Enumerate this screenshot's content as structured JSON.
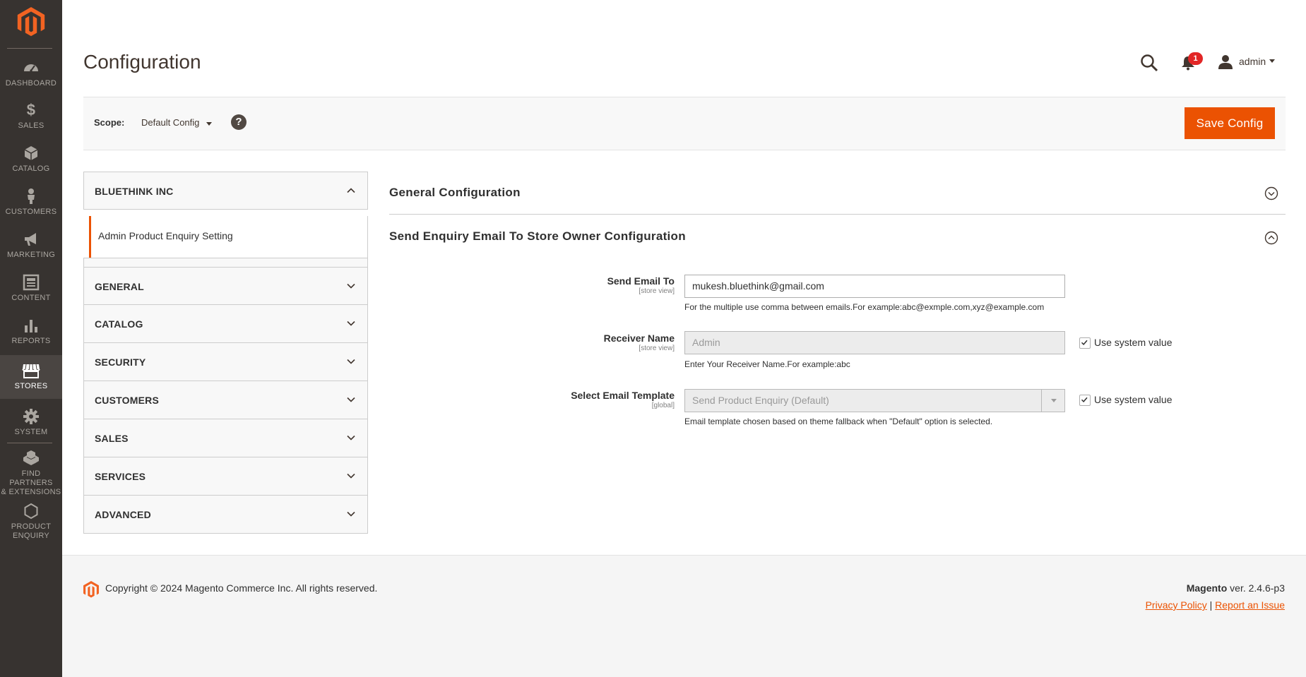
{
  "sidebar": {
    "items": [
      {
        "label": "DASHBOARD",
        "icon": "dashboard-icon"
      },
      {
        "label": "SALES",
        "icon": "dollar-icon"
      },
      {
        "label": "CATALOG",
        "icon": "cube-icon"
      },
      {
        "label": "CUSTOMERS",
        "icon": "person-icon"
      },
      {
        "label": "MARKETING",
        "icon": "megaphone-icon"
      },
      {
        "label": "CONTENT",
        "icon": "content-icon"
      },
      {
        "label": "REPORTS",
        "icon": "bar-chart-icon"
      },
      {
        "label": "STORES",
        "icon": "store-icon"
      },
      {
        "label": "SYSTEM",
        "icon": "gear-icon"
      },
      {
        "label_line1": "FIND PARTNERS",
        "label_line2": "& EXTENSIONS",
        "icon": "boxes-icon"
      },
      {
        "label_line1": "PRODUCT",
        "label_line2": "ENQUIRY",
        "icon": "hexagon-icon"
      }
    ],
    "active": "STORES"
  },
  "header": {
    "title": "Configuration",
    "notification_count": "1",
    "username": "admin"
  },
  "scope_bar": {
    "label": "Scope:",
    "value": "Default Config",
    "help": "?",
    "save_label": "Save Config"
  },
  "tabs": {
    "group_label": "BLUETHINK INC",
    "active_item": "Admin Product Enquiry Setting",
    "items": [
      "GENERAL",
      "CATALOG",
      "SECURITY",
      "CUSTOMERS",
      "SALES",
      "SERVICES",
      "ADVANCED"
    ]
  },
  "sections": {
    "general": {
      "title": "General Configuration"
    },
    "send_enquiry": {
      "title": "Send Enquiry Email To Store Owner Configuration"
    }
  },
  "form": {
    "send_email_to": {
      "label": "Send Email To",
      "scope": "[store view]",
      "value": "mukesh.bluethink@gmail.com",
      "note": "For the multiple use comma between emails.For example:abc@exmple.com,xyz@example.com"
    },
    "receiver_name": {
      "label": "Receiver Name",
      "scope": "[store view]",
      "value": "Admin",
      "note": "Enter Your Receiver Name.For example:abc",
      "use_system_value": "Use system value"
    },
    "email_template": {
      "label": "Select Email Template",
      "scope": "[global]",
      "value": "Send Product Enquiry (Default)",
      "note": "Email template chosen based on theme fallback when \"Default\" option is selected.",
      "use_system_value": "Use system value"
    }
  },
  "footer": {
    "copyright": "Copyright © 2024 Magento Commerce Inc. All rights reserved.",
    "brand": "Magento",
    "version": " ver. 2.4.6-p3",
    "privacy": "Privacy Policy",
    "separator": "|",
    "report": "Report an Issue"
  },
  "colors": {
    "accent": "#eb5202",
    "sidebar_bg": "#373330",
    "badge": "#e22626"
  }
}
